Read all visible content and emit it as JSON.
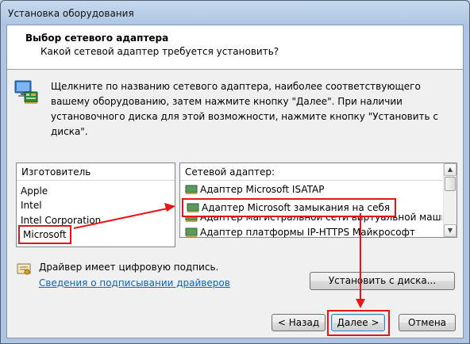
{
  "window": {
    "title": "Установка оборудования"
  },
  "header": {
    "title": "Выбор сетевого адаптера",
    "subtitle": "Какой сетевой адаптер требуется установить?"
  },
  "instructions": "Щелкните по названию сетевого адаптера, наиболее соответствующего вашему оборудованию, затем нажмите кнопку \"Далее\". При наличии установочного диска для этой возможности, нажмите кнопку \"Установить с диска\".",
  "manufacturers": {
    "header": "Изготовитель",
    "items": [
      "Apple",
      "Intel",
      "Intel Corporation",
      "Microsoft"
    ],
    "selected": "Microsoft"
  },
  "adapters": {
    "header": "Сетевой адаптер:",
    "items": [
      "Адаптер Microsoft ISATAP",
      "Адаптер Microsoft замыкания на себя",
      "Адаптер магистральной сети виртуальной машины (Ма",
      "Адаптер платформы IP-HTTPS Майкрософт"
    ],
    "selected": "Адаптер Microsoft замыкания на себя"
  },
  "driver": {
    "signed_text": "Драйвер имеет цифровую подпись.",
    "link": "Сведения о подписывании драйверов"
  },
  "buttons": {
    "have_disk": "Установить с диска...",
    "back": "< Назад",
    "next": "Далее >",
    "cancel": "Отмена"
  },
  "colors": {
    "annotation": "#e8141a",
    "link": "#0066cc"
  }
}
